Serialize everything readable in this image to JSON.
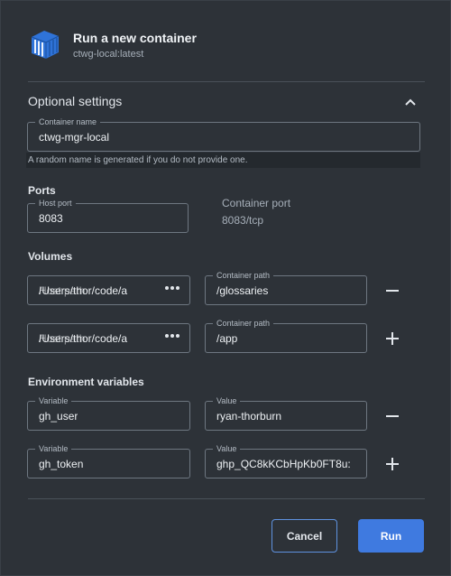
{
  "header": {
    "title": "Run a new container",
    "subtitle": "ctwg-local:latest",
    "icon": "container-icon"
  },
  "optional": {
    "title": "Optional settings",
    "toggle_icon": "chevron-up-icon"
  },
  "container_name": {
    "label": "Container name",
    "value": "ctwg-mgr-local",
    "helper": "A random name is generated if you do not provide one."
  },
  "ports": {
    "title": "Ports",
    "host_label": "Host port",
    "host_value": "8083",
    "container_label": "Container port",
    "container_value": "8083/tcp"
  },
  "volumes": {
    "title": "Volumes",
    "rows": [
      {
        "host_placeholder": "Host path",
        "host_value": "/Users/thor/code/a",
        "container_label": "Container path",
        "container_value": "/glossaries",
        "action": "minus-icon"
      },
      {
        "host_placeholder": "Host path",
        "host_value": "/Users/thor/code/a",
        "container_label": "Container path",
        "container_value": "/app",
        "action": "plus-icon"
      }
    ]
  },
  "env": {
    "title": "Environment variables",
    "rows": [
      {
        "var_label": "Variable",
        "var_value": "gh_user",
        "val_label": "Value",
        "val_value": "ryan-thorburn",
        "action": "minus-icon"
      },
      {
        "var_label": "Variable",
        "var_value": "gh_token",
        "val_label": "Value",
        "val_value": "ghp_QC8kKCbHpKb0FT8u:",
        "action": "plus-icon"
      }
    ]
  },
  "footer": {
    "cancel_label": "Cancel",
    "run_label": "Run"
  },
  "colors": {
    "background": "#2d3238",
    "accent": "#3f7ae0",
    "border": "#6e7781"
  }
}
